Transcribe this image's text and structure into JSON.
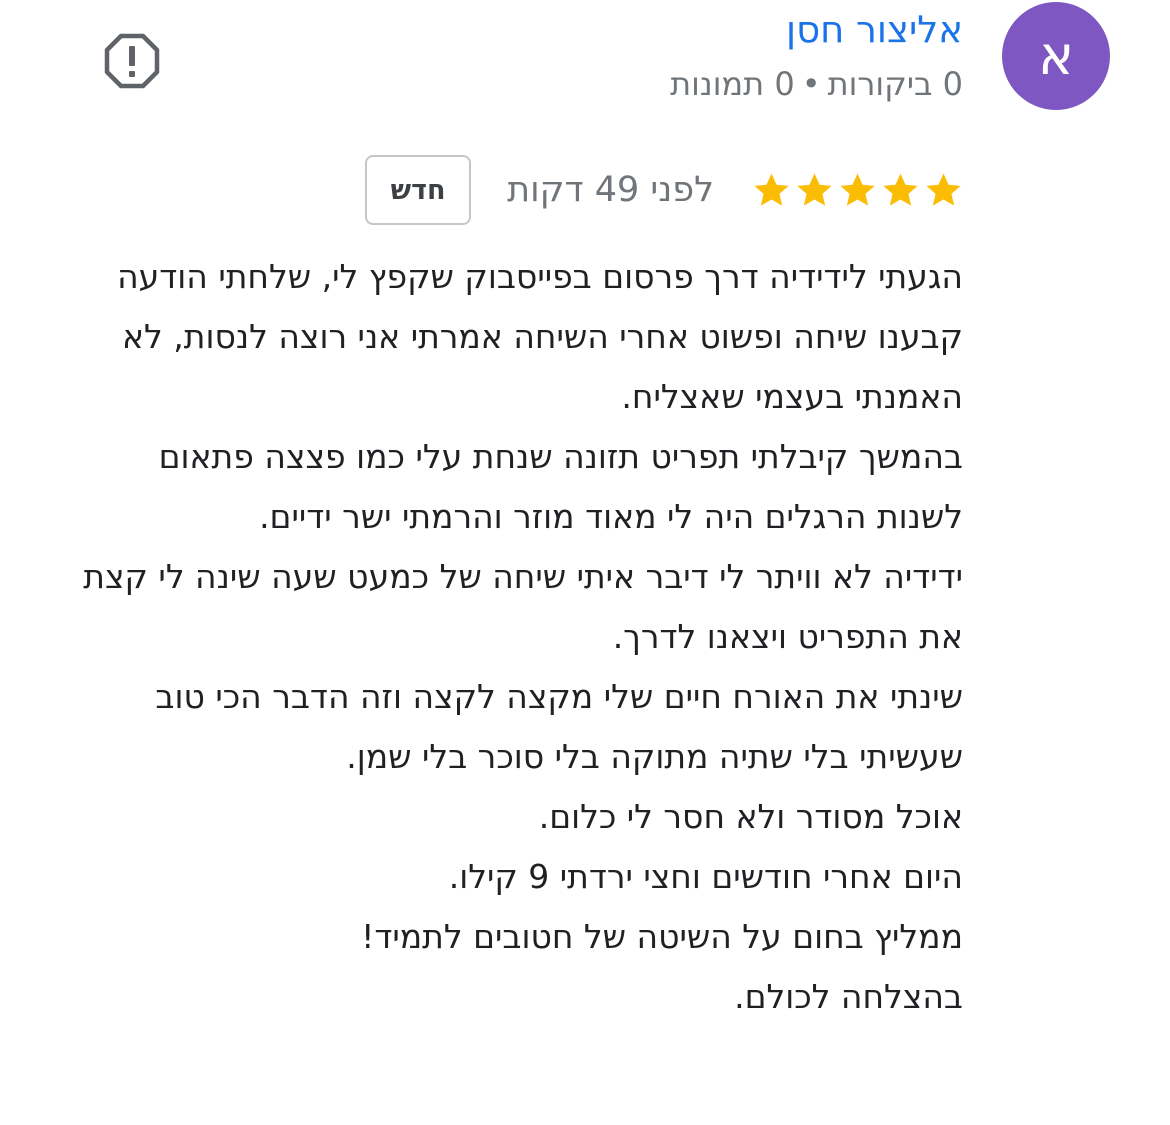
{
  "colors": {
    "avatar_bg": "#7e57c2",
    "name": "#1a73e8",
    "star": "#fbbc04",
    "report_icon": "#5f6368"
  },
  "author": {
    "avatar_letter": "א",
    "name": "אליצור חסן",
    "reviews_count": "0 ביקורות",
    "separator": "•",
    "photos_count": "0 תמונות"
  },
  "report_button": {
    "icon": "report-flag-icon"
  },
  "review": {
    "rating": 5,
    "max_rating": 5,
    "star_icon": "star-icon",
    "time": "לפני 49 דקות",
    "badge": "חדש",
    "paragraphs": [
      "הגעתי לידידיה דרך פרסום בפייסבוק שקפץ לי, שלחתי הודעה קבענו שיחה ופשוט אחרי השיחה אמרתי אני רוצה לנסות, לא האמנתי בעצמי שאצליח.",
      "בהמשך קיבלתי תפריט תזונה שנחת עלי כמו פצצה פתאום לשנות הרגלים היה לי מאוד מוזר והרמתי ישר ידיים.",
      "ידידיה לא וויתר לי דיבר איתי שיחה של כמעט שעה שינה לי קצת את התפריט ויצאנו לדרך.",
      "שינתי את האורח חיים שלי מקצה לקצה וזה הדבר הכי טוב שעשיתי בלי שתיה מתוקה בלי סוכר בלי שמן.",
      "אוכל מסודר ולא חסר לי כלום.",
      "היום אחרי חודשים וחצי ירדתי 9 קילו.",
      "ממליץ בחום על השיטה של חטובים לתמיד!",
      "בהצלחה לכולם."
    ]
  }
}
